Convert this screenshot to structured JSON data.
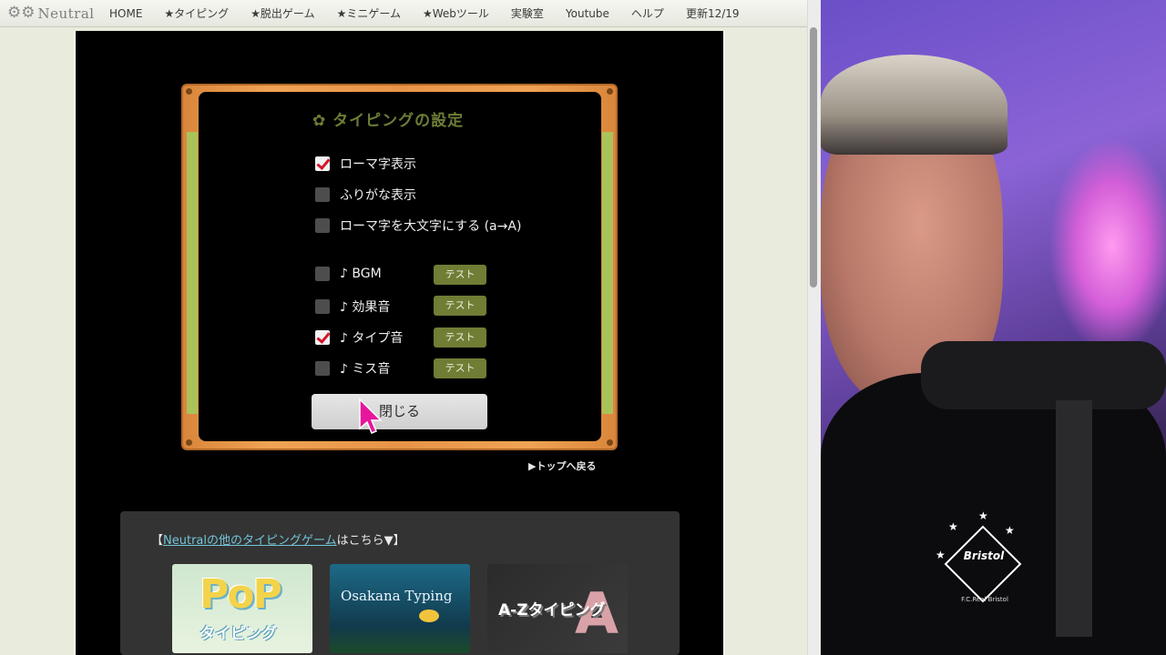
{
  "nav": {
    "logo_text": "Neutral",
    "items": [
      "HOME",
      "★タイピング",
      "★脱出ゲーム",
      "★ミニゲーム",
      "★Webツール",
      "実験室",
      "Youtube",
      "ヘルプ",
      "更新12/19"
    ]
  },
  "settings": {
    "title": "タイピングの設定",
    "options": [
      {
        "label": "ローマ字表示",
        "checked": true
      },
      {
        "label": "ふりがな表示",
        "checked": false
      },
      {
        "label": "ローマ字を大文字にする (a→A)",
        "checked": false
      }
    ],
    "sounds": [
      {
        "label": "♪ BGM",
        "checked": false,
        "test_label": "テスト"
      },
      {
        "label": "♪ 効果音",
        "checked": false,
        "test_label": "テスト"
      },
      {
        "label": "♪ タイプ音",
        "checked": true,
        "test_label": "テスト"
      },
      {
        "label": "♪ ミス音",
        "checked": false,
        "test_label": "テスト"
      }
    ],
    "close_label": "閉じる",
    "back_link": "▶トップへ戻る"
  },
  "others": {
    "bracket_open": "【",
    "link_text": "Neutralの他のタイピングゲーム",
    "suffix": "はこちら▼】",
    "games": [
      {
        "title_main": "PoP",
        "title_sub": "タイピング"
      },
      {
        "title_main": "Osakana Typing"
      },
      {
        "title_main": "A-Zタイピング",
        "letter": "A"
      }
    ]
  },
  "webcam": {
    "shirt_logo": "Bristol",
    "shirt_sub": "F.C.Real Bristol"
  },
  "colors": {
    "frame_orange": "#f0a354",
    "frame_green": "#a9c35a",
    "title_green": "#6c7e35",
    "test_button": "#6f7d35",
    "checkmark_red": "#d3162b",
    "link_cyan": "#73c5d8",
    "cursor_magenta": "#e6179c"
  },
  "icons": {
    "logo": "gear-icon",
    "settings_title": "flower-gear-icon",
    "cursor": "pointer-arrow-icon"
  }
}
